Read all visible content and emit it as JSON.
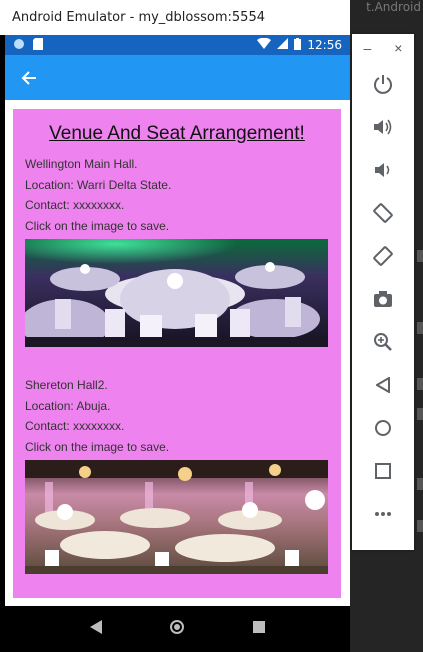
{
  "window": {
    "title": "Android Emulator - my_dblossom:5554"
  },
  "ide": {
    "background_text": "t.Android"
  },
  "status_bar": {
    "time": "12:56"
  },
  "page": {
    "title": "Venue And Seat Arrangement!"
  },
  "venues": [
    {
      "name": "Wellington Main Hall.",
      "location": "Location: Warri Delta State.",
      "contact": "Contact: xxxxxxxx.",
      "hint": "Click on the image to save."
    },
    {
      "name": "Shereton Hall2.",
      "location": "Location: Abuja.",
      "contact": "Contact: xxxxxxxx.",
      "hint": "Click on the image to save."
    }
  ],
  "colors": {
    "status_bar": "#1565c0",
    "app_bar": "#2196f3",
    "panel": "#ee82ee"
  },
  "toolbar": {
    "minimize": "–",
    "close": "×",
    "tools": [
      "power-icon",
      "volume-up-icon",
      "volume-down-icon",
      "rotate-left-icon",
      "rotate-right-icon",
      "camera-icon",
      "zoom-icon",
      "back-icon",
      "home-icon",
      "overview-icon",
      "more-icon"
    ]
  }
}
